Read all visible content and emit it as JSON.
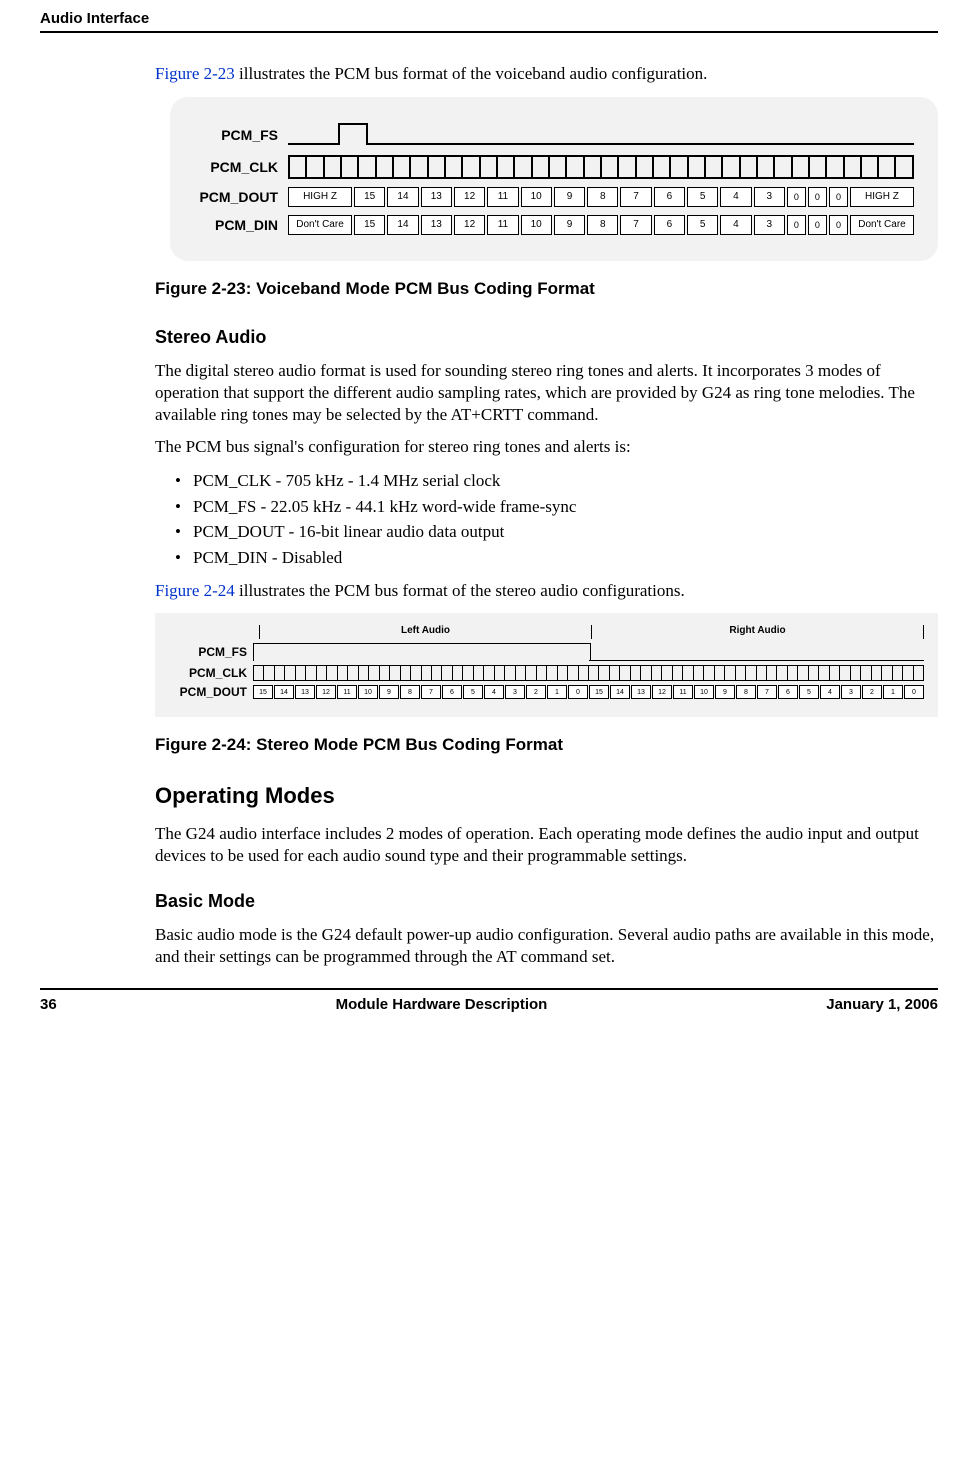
{
  "header": {
    "running": "Audio Interface"
  },
  "intro1": {
    "figref": "Figure 2-23",
    "rest": " illustrates the PCM bus format of the voiceband audio configuration."
  },
  "fig23": {
    "labels": {
      "fs": "PCM_FS",
      "clk": "PCM_CLK",
      "dout": "PCM_DOUT",
      "din": "PCM_DIN"
    },
    "dout_cells": [
      "HIGH Z",
      "15",
      "14",
      "13",
      "12",
      "11",
      "10",
      "9",
      "8",
      "7",
      "6",
      "5",
      "4",
      "3",
      "0",
      "0",
      "0",
      "HIGH Z"
    ],
    "din_cells": [
      "Don't Care",
      "15",
      "14",
      "13",
      "12",
      "11",
      "10",
      "9",
      "8",
      "7",
      "6",
      "5",
      "4",
      "3",
      "0",
      "0",
      "0",
      "Don't Care"
    ],
    "caption": "Figure 2-23: Voiceband Mode PCM Bus Coding Format"
  },
  "stereo": {
    "heading": "Stereo Audio",
    "para1": "The digital stereo audio format is used for sounding stereo ring tones and alerts. It incorporates 3 modes of operation that support the different audio sampling rates, which are provided by G24 as ring tone melodies. The available ring tones may be selected by the AT+CRTT command.",
    "para2": "The PCM bus signal's configuration for stereo ring tones and alerts is:",
    "bullets": [
      "PCM_CLK - 705 kHz - 1.4 MHz serial clock",
      "PCM_FS - 22.05 kHz - 44.1 kHz word-wide frame-sync",
      "PCM_DOUT - 16-bit linear audio data output",
      "PCM_DIN - Disabled"
    ],
    "figref": "Figure 2-24",
    "after": " illustrates the PCM bus format of the stereo audio configurations."
  },
  "fig24": {
    "left_label": "Left Audio",
    "right_label": "Right Audio",
    "labels": {
      "fs": "PCM_FS",
      "clk": "PCM_CLK",
      "dout": "PCM_DOUT"
    },
    "bits": [
      "15",
      "14",
      "13",
      "12",
      "11",
      "10",
      "9",
      "8",
      "7",
      "6",
      "5",
      "4",
      "3",
      "2",
      "1",
      "0",
      "15",
      "14",
      "13",
      "12",
      "11",
      "10",
      "9",
      "8",
      "7",
      "6",
      "5",
      "4",
      "3",
      "2",
      "1",
      "0"
    ],
    "caption": "Figure 2-24: Stereo Mode PCM Bus Coding Format"
  },
  "opmodes": {
    "heading": "Operating Modes",
    "para": "The G24 audio interface includes 2 modes of operation. Each operating mode defines the audio input and output devices to be used for each audio sound type and their programmable settings."
  },
  "basic": {
    "heading": "Basic Mode",
    "para": "Basic audio mode is the G24 default power-up audio configuration. Several audio paths are available in this mode, and their settings can be programmed through the AT command set."
  },
  "footer": {
    "page": "36",
    "center": "Module Hardware Description",
    "date": "January 1, 2006"
  }
}
